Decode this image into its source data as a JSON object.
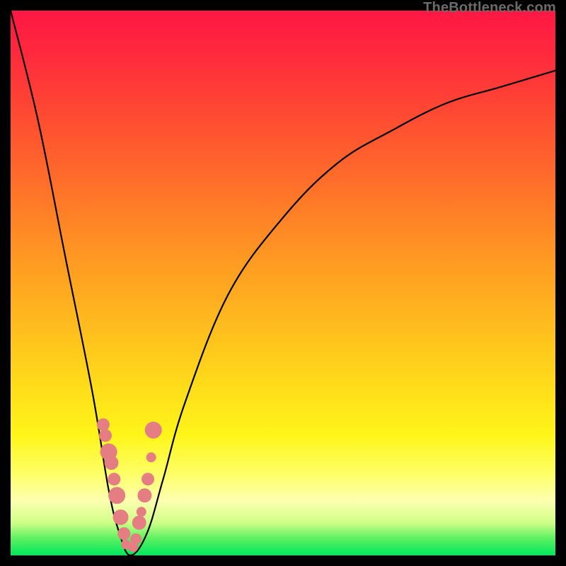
{
  "attribution": {
    "text": "TheBottleneck.com"
  },
  "colors": {
    "background": "#000000",
    "curve": "#000000",
    "accent_dots": "#e57e82",
    "gradient_top": "#ff1744",
    "gradient_bottom": "#00e85e"
  },
  "chart_data": {
    "type": "line",
    "title": "",
    "xlabel": "",
    "ylabel": "",
    "xlim": [
      0,
      100
    ],
    "ylim": [
      0,
      100
    ],
    "grid": false,
    "legend": false,
    "series": [
      {
        "name": "bottleneck-curve",
        "x": [
          0,
          5,
          10,
          15,
          18,
          20,
          22,
          25,
          28,
          32,
          40,
          50,
          60,
          70,
          80,
          90,
          100
        ],
        "y": [
          100,
          80,
          55,
          30,
          12,
          4,
          0,
          4,
          14,
          28,
          48,
          62,
          72,
          78,
          83,
          86,
          89
        ]
      }
    ],
    "accent_points": {
      "name": "highlight-dots",
      "x": [
        17.0,
        17.4,
        18.0,
        18.5,
        19.0,
        19.5,
        20.2,
        20.8,
        21.2,
        22.5,
        23.0,
        23.6,
        24.0,
        24.6,
        25.2,
        25.8,
        26.2
      ],
      "y": [
        24,
        22,
        19,
        17,
        14,
        11,
        7,
        4,
        2,
        1.5,
        3,
        6,
        8,
        11,
        14,
        18,
        23
      ],
      "r": [
        9,
        9,
        12,
        10,
        9,
        12,
        11,
        9,
        7,
        7,
        8,
        10,
        7,
        10,
        9,
        7,
        12
      ]
    }
  }
}
